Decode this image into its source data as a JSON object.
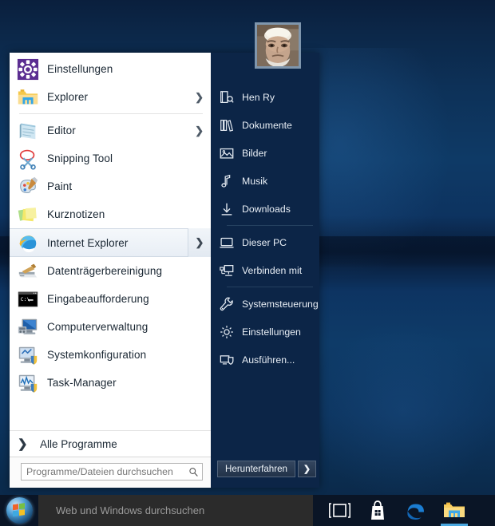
{
  "desktop": {
    "wallpaper_colors": [
      "#0a1f3d",
      "#0e3b68",
      "#09203f"
    ]
  },
  "start_menu": {
    "programs": [
      {
        "label": "Einstellungen",
        "icon": "settings-gear-icon",
        "chevron": "",
        "selected": false,
        "sep_after": false
      },
      {
        "label": "Explorer",
        "icon": "folder-explorer-icon",
        "chevron": "❯",
        "selected": false,
        "sep_after": true
      },
      {
        "label": "Editor",
        "icon": "notepad-icon",
        "chevron": "❯",
        "selected": false,
        "sep_after": false
      },
      {
        "label": "Snipping Tool",
        "icon": "scissors-icon",
        "chevron": "",
        "selected": false,
        "sep_after": false
      },
      {
        "label": "Paint",
        "icon": "paint-palette-icon",
        "chevron": "",
        "selected": false,
        "sep_after": false
      },
      {
        "label": "Kurznotizen",
        "icon": "sticky-notes-icon",
        "chevron": "",
        "selected": false,
        "sep_after": false
      },
      {
        "label": "Internet Explorer",
        "icon": "internet-explorer-icon",
        "chevron": "❯",
        "selected": true,
        "sep_after": false
      },
      {
        "label": "Datenträgerbereinigung",
        "icon": "disk-cleanup-icon",
        "chevron": "",
        "selected": false,
        "sep_after": false
      },
      {
        "label": "Eingabeaufforderung",
        "icon": "command-prompt-icon",
        "chevron": "",
        "selected": false,
        "sep_after": false
      },
      {
        "label": "Computerverwaltung",
        "icon": "computer-management-icon",
        "chevron": "",
        "selected": false,
        "sep_after": false
      },
      {
        "label": "Systemkonfiguration",
        "icon": "system-configuration-icon",
        "chevron": "",
        "selected": false,
        "sep_after": false
      },
      {
        "label": "Task-Manager",
        "icon": "task-manager-icon",
        "chevron": "",
        "selected": false,
        "sep_after": false
      }
    ],
    "all_programs": {
      "label": "Alle Programme",
      "arrow": "❯"
    },
    "search": {
      "placeholder": "Programme/Dateien durchsuchen",
      "value": "",
      "icon": "search-magnifier-icon"
    },
    "user": {
      "name": "Hen Ry",
      "avatar": "user-avatar-photo"
    },
    "places": [
      {
        "label": "Hen Ry",
        "icon": "personal-folder-icon",
        "sep_after": false
      },
      {
        "label": "Dokumente",
        "icon": "documents-icon",
        "sep_after": false
      },
      {
        "label": "Bilder",
        "icon": "pictures-icon",
        "sep_after": false
      },
      {
        "label": "Musik",
        "icon": "music-note-icon",
        "sep_after": false
      },
      {
        "label": "Downloads",
        "icon": "downloads-arrow-icon",
        "sep_after": true
      },
      {
        "label": "Dieser PC",
        "icon": "this-pc-icon",
        "sep_after": false
      },
      {
        "label": "Verbinden mit",
        "icon": "connect-to-icon",
        "sep_after": true
      },
      {
        "label": "Systemsteuerung",
        "icon": "wrench-icon",
        "sep_after": false
      },
      {
        "label": "Einstellungen",
        "icon": "gear-icon",
        "sep_after": false
      },
      {
        "label": "Ausführen...",
        "icon": "run-shield-icon",
        "sep_after": false
      }
    ],
    "shutdown": {
      "label": "Herunterfahren",
      "arrow": "❯"
    }
  },
  "taskbar": {
    "start_button": "windows-orb-start-icon",
    "search_placeholder": "Web und Windows durchsuchen",
    "icons": [
      {
        "name": "task-view-icon",
        "active": false
      },
      {
        "name": "microsoft-store-icon",
        "active": false
      },
      {
        "name": "microsoft-edge-icon",
        "active": false
      },
      {
        "name": "file-explorer-icon",
        "active": true
      }
    ]
  }
}
